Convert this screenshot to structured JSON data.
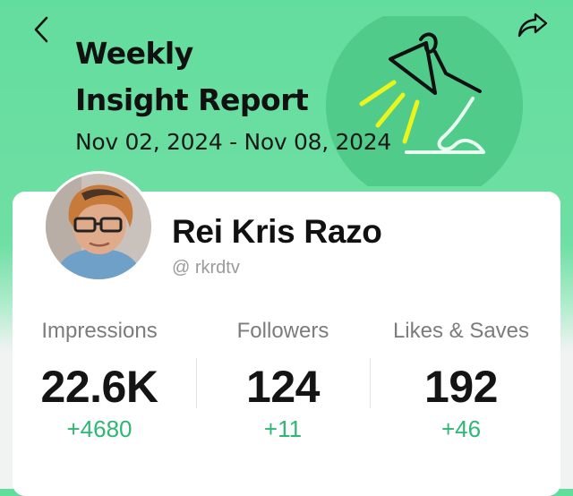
{
  "header": {
    "title_line1": "Weekly",
    "title_line2": "Insight Report",
    "date_range": "Nov 02, 2024 - Nov 08, 2024",
    "background_color": "#63dd9d",
    "back_icon": "chevron-left-icon",
    "share_icon": "share-arrow-icon",
    "illustration": "desk-lamp-illustration"
  },
  "profile": {
    "name": "Rei Kris Razo",
    "handle": "@ rkrdtv"
  },
  "stats": [
    {
      "label": "Impressions",
      "value": "22.6K",
      "delta": "+4680"
    },
    {
      "label": "Followers",
      "value": "124",
      "delta": "+11"
    },
    {
      "label": "Likes & Saves",
      "value": "192",
      "delta": "+46"
    }
  ],
  "colors": {
    "accent_green": "#2fb775",
    "lamp_light": "#e9f51d"
  }
}
